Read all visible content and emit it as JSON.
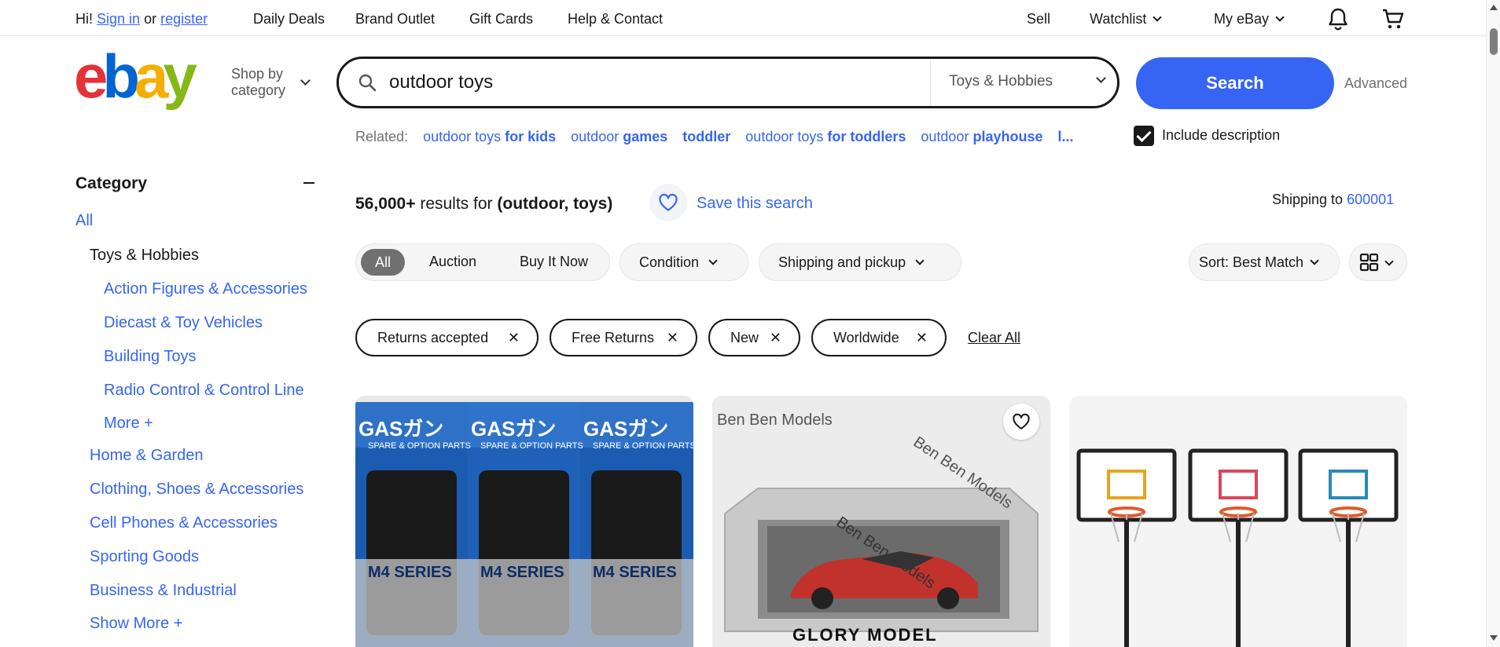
{
  "topbar": {
    "greeting_prefix": "Hi!",
    "sign_in": "Sign in",
    "or": "or",
    "register": "register",
    "links": [
      "Daily Deals",
      "Brand Outlet",
      "Gift Cards",
      "Help & Contact"
    ],
    "sell": "Sell",
    "watchlist": "Watchlist",
    "my_ebay": "My eBay"
  },
  "header": {
    "shop_by_line1": "Shop by",
    "shop_by_line2": "category",
    "search_value": "outdoor toys",
    "search_category": "Toys & Hobbies",
    "search_button": "Search",
    "advanced": "Advanced"
  },
  "related": {
    "label": "Related:",
    "items": [
      {
        "plain": "outdoor toys ",
        "bold": "for kids"
      },
      {
        "plain": "outdoor ",
        "bold": "games"
      },
      {
        "plain": "",
        "bold": "toddler"
      },
      {
        "plain": "outdoor toys ",
        "bold": "for toddlers"
      },
      {
        "plain": "outdoor ",
        "bold": "playhouse"
      },
      {
        "plain": "",
        "bold": "l..."
      }
    ],
    "include_description": "Include description"
  },
  "sidebar": {
    "heading": "Category",
    "all": "All",
    "current": "Toys & Hobbies",
    "subcategories": [
      "Action Figures & Accessories",
      "Diecast & Toy Vehicles",
      "Building Toys",
      "Radio Control & Control Line"
    ],
    "more": "More +",
    "categories": [
      "Home & Garden",
      "Clothing, Shoes & Accessories",
      "Cell Phones & Accessories",
      "Sporting Goods",
      "Business & Industrial"
    ],
    "show_more": "Show More +"
  },
  "results": {
    "count": "56,000+",
    "results_for": " results for ",
    "query": "(outdoor, toys)",
    "save_search": "Save this search",
    "shipping_to": "Shipping to",
    "zip": "600001"
  },
  "filters": {
    "buying_options": [
      "All",
      "Auction",
      "Buy It Now"
    ],
    "condition": "Condition",
    "shipping": "Shipping and pickup",
    "sort": "Sort: Best Match"
  },
  "chips": [
    "Returns accepted",
    "Free Returns",
    "New",
    "Worldwide"
  ],
  "clear_all": "Clear All",
  "cards": {
    "card1_brand": "GASガン",
    "card1_sub": "SPARE & OPTION PARTS",
    "card1_series": "M4 SERIES",
    "card2_watermark": "Ben Ben Models",
    "card2_signature": "GLORY MODEL"
  },
  "colors": {
    "link": "#3665f3",
    "search_button": "#3665f3",
    "text": "#191919"
  }
}
